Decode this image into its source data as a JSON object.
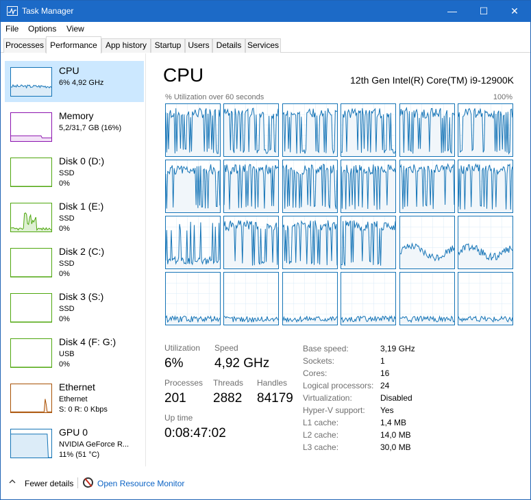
{
  "window": {
    "title": "Task Manager",
    "minimize": "—",
    "maximize": "☐",
    "close": "✕"
  },
  "menu": [
    "File",
    "Options",
    "View"
  ],
  "tabs": [
    "Processes",
    "Performance",
    "App history",
    "Startup",
    "Users",
    "Details",
    "Services"
  ],
  "active_tab": "Performance",
  "sidebar": [
    {
      "title": "CPU",
      "line1": "6% 4,92 GHz",
      "line2": "",
      "color": "#1373b6"
    },
    {
      "title": "Memory",
      "line1": "5,2/31,7 GB (16%)",
      "line2": "",
      "color": "#8b12ae"
    },
    {
      "title": "Disk 0 (D:)",
      "line1": "SSD",
      "line2": "0%",
      "color": "#4da60c"
    },
    {
      "title": "Disk 1 (E:)",
      "line1": "SSD",
      "line2": "0%",
      "color": "#4da60c"
    },
    {
      "title": "Disk 2 (C:)",
      "line1": "SSD",
      "line2": "0%",
      "color": "#4da60c"
    },
    {
      "title": "Disk 3 (S:)",
      "line1": "SSD",
      "line2": "0%",
      "color": "#4da60c"
    },
    {
      "title": "Disk 4 (F: G:)",
      "line1": "USB",
      "line2": "0%",
      "color": "#4da60c"
    },
    {
      "title": "Ethernet",
      "line1": "Ethernet",
      "line2": "S: 0  R: 0 Kbps",
      "color": "#a74f01"
    },
    {
      "title": "GPU 0",
      "line1": "NVIDIA GeForce R...",
      "line2": "11% (51 °C)",
      "color": "#1373b6"
    }
  ],
  "main": {
    "title": "CPU",
    "cpu_name": "12th Gen Intel(R) Core(TM) i9-12900K",
    "graph_label": "% Utilization over 60 seconds",
    "graph_max": "100%",
    "graph_color": "#1373b6",
    "graph_fill": "#f1f6fa"
  },
  "stats": {
    "utilization_label": "Utilization",
    "utilization": "6%",
    "speed_label": "Speed",
    "speed": "4,92 GHz",
    "processes_label": "Processes",
    "processes": "201",
    "threads_label": "Threads",
    "threads": "2882",
    "handles_label": "Handles",
    "handles": "84179",
    "uptime_label": "Up time",
    "uptime": "0:08:47:02"
  },
  "specs": [
    {
      "label": "Base speed:",
      "value": "3,19 GHz"
    },
    {
      "label": "Sockets:",
      "value": "1"
    },
    {
      "label": "Cores:",
      "value": "16"
    },
    {
      "label": "Logical processors:",
      "value": "24"
    },
    {
      "label": "Virtualization:",
      "value": "Disabled"
    },
    {
      "label": "Hyper-V support:",
      "value": "Yes"
    },
    {
      "label": "L1 cache:",
      "value": "1,4 MB"
    },
    {
      "label": "L2 cache:",
      "value": "14,0 MB"
    },
    {
      "label": "L3 cache:",
      "value": "30,0 MB"
    }
  ],
  "footer": {
    "fewer_details": "Fewer details",
    "open_resource_monitor": "Open Resource Monitor"
  }
}
